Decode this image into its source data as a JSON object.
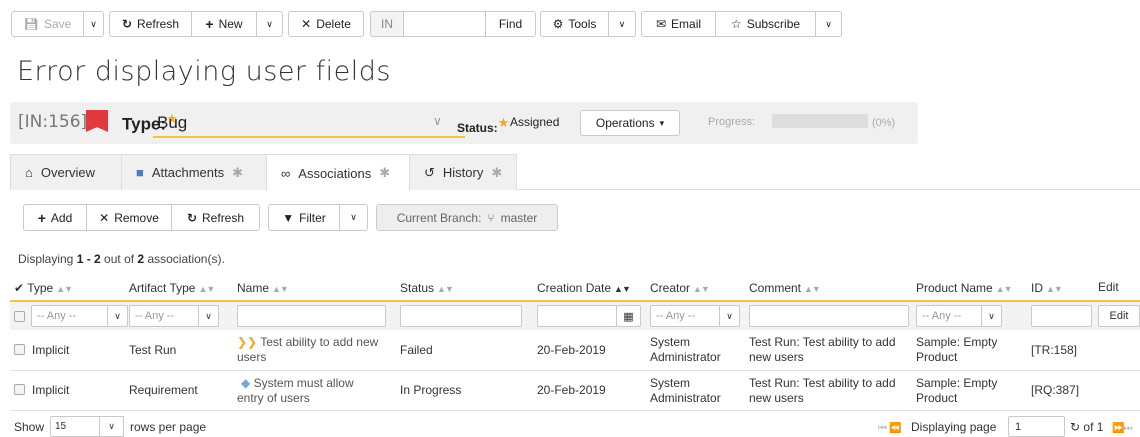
{
  "toolbar": {
    "save": "Save",
    "refresh": "Refresh",
    "new": "New",
    "delete": "Delete",
    "token_prefix": "IN",
    "token_value": "",
    "find": "Find",
    "tools": "Tools",
    "email": "Email",
    "subscribe": "Subscribe"
  },
  "page_title": "Error displaying user fields",
  "header": {
    "token": "[IN:156]",
    "type_label": "Type:",
    "type_value": "Bug",
    "status_label": "Status:",
    "status_value": "Assigned",
    "operations": "Operations",
    "progress_label": "Progress:",
    "progress_pct": "(0%)",
    "progress_value": 0,
    "flag_color": "#e0393e"
  },
  "tabs": [
    {
      "label": "Overview",
      "star": ""
    },
    {
      "label": "Attachments",
      "star": "✱"
    },
    {
      "label": "Associations",
      "star": "✱"
    },
    {
      "label": "History",
      "star": "✱"
    }
  ],
  "assoc_toolbar": {
    "add": "Add",
    "remove": "Remove",
    "refresh": "Refresh",
    "filter": "Filter",
    "branch_label": "Current Branch:",
    "branch_value": "master"
  },
  "displaying": {
    "pre": "Displaying ",
    "from": "1 - 2",
    "mid": " out of ",
    "total": "2",
    "post": " association(s)."
  },
  "columns": {
    "type": "Type",
    "artifact_type": "Artifact Type",
    "name": "Name",
    "status": "Status",
    "creation_date": "Creation Date",
    "creator": "Creator",
    "comment": "Comment",
    "product_name": "Product Name",
    "id": "ID",
    "edit": "Edit"
  },
  "filters": {
    "any": "-- Any --",
    "edit_button": "Edit"
  },
  "rows": [
    {
      "type": "Implicit",
      "artifact_type": "Test Run",
      "name_line1": "Test ability to add new",
      "name_line2": "users",
      "status": "Failed",
      "date": "20-Feb-2019",
      "creator_line1": "System",
      "creator_line2": "Administrator",
      "comment_line1": "Test Run: Test ability to add",
      "comment_line2": "new users",
      "product_line1": "Sample: Empty",
      "product_line2": "Product",
      "id": "[TR:158]"
    },
    {
      "type": "Implicit",
      "artifact_type": "Requirement",
      "name_line1": "System must allow",
      "name_line2": "entry of users",
      "status": "In Progress",
      "date": "20-Feb-2019",
      "creator_line1": "System",
      "creator_line2": "Administrator",
      "comment_line1": "Test Run: Test ability to add",
      "comment_line2": "new users",
      "product_line1": "Sample: Empty",
      "product_line2": "Product",
      "id": "[RQ:387]"
    }
  ],
  "footer": {
    "show": "Show",
    "rows_value": "15",
    "rows_per_page": "rows per page",
    "displaying_page": "Displaying page",
    "page": "1",
    "of": "of 1"
  }
}
